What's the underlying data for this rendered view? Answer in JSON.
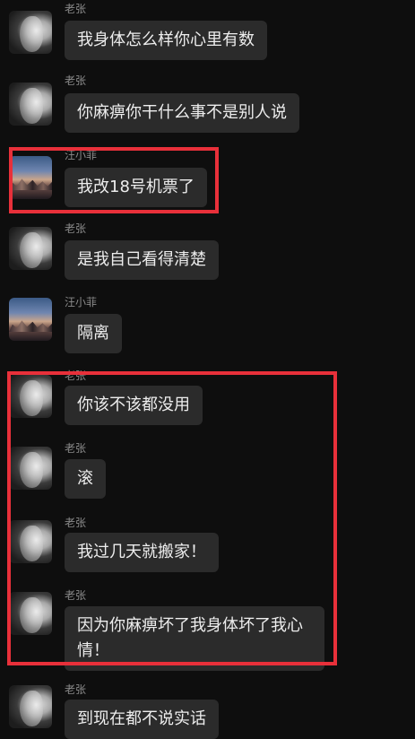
{
  "messages": [
    {
      "sender": "老张",
      "avatar": "laozhang-avatar",
      "text": "我身体怎么样你心里有数"
    },
    {
      "sender": "老张",
      "avatar": "laozhang-avatar",
      "text": "你麻痹你干什么事不是别人说"
    },
    {
      "sender": "汪小菲",
      "avatar": "wangxiaofei-avatar",
      "text": "我改18号机票了"
    },
    {
      "sender": "老张",
      "avatar": "laozhang-avatar",
      "text": "是我自己看得清楚"
    },
    {
      "sender": "汪小菲",
      "avatar": "wangxiaofei-avatar",
      "text": "隔离"
    },
    {
      "sender": "老张",
      "avatar": "laozhang-avatar",
      "text": "你该不该都没用"
    },
    {
      "sender": "老张",
      "avatar": "laozhang-avatar",
      "text": "滚"
    },
    {
      "sender": "老张",
      "avatar": "laozhang-avatar",
      "text": "我过几天就搬家！"
    },
    {
      "sender": "老张",
      "avatar": "laozhang-avatar",
      "text": "因为你麻痹坏了我身体坏了我心情！"
    },
    {
      "sender": "老张",
      "avatar": "laozhang-avatar",
      "text": "到现在都不说实话"
    }
  ],
  "highlight_color": "#e8303a",
  "bubble_color": "#2b2b2b",
  "background_color": "#0e0e0e"
}
